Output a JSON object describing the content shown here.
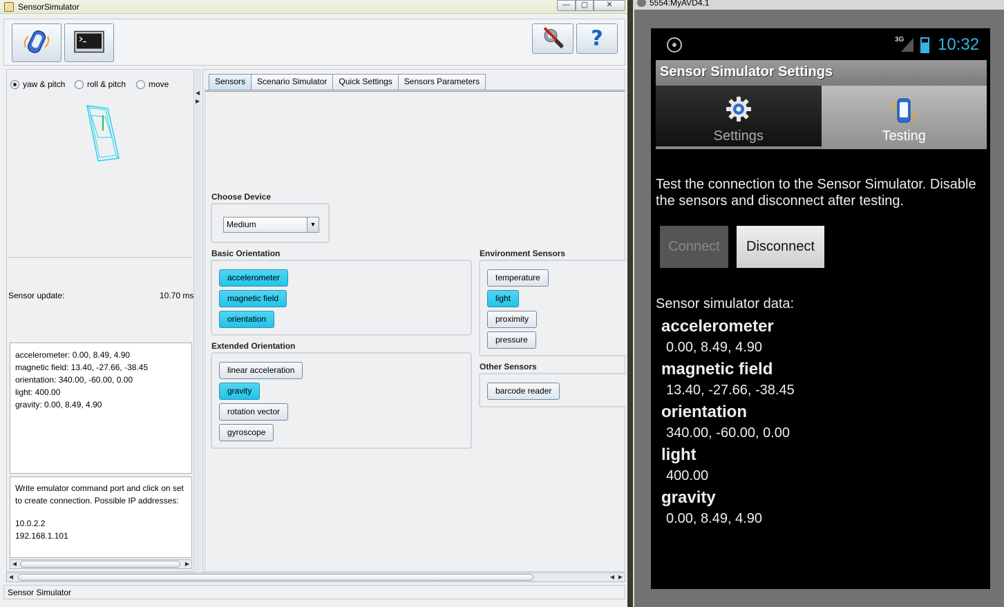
{
  "java_window": {
    "title": "SensorSimulator",
    "window_buttons": {
      "minimize": "—",
      "maximize": "▢",
      "close": "✕"
    },
    "toolbar": {
      "connect_icon": "phone-icon",
      "terminal_icon": "terminal-icon",
      "settings_icon": "tools-icon",
      "help_icon": "help-icon",
      "help_label": "?"
    },
    "left_panel": {
      "radio_options": [
        {
          "label": "yaw & pitch",
          "selected": true
        },
        {
          "label": "roll & pitch",
          "selected": false
        },
        {
          "label": "move",
          "selected": false
        }
      ],
      "sensor_update_label": "Sensor update:",
      "sensor_update_value": "10.70 ms",
      "sensor_values": [
        "accelerometer: 0.00, 8.49, 4.90",
        "magnetic field: 13.40, -27.66, -38.45",
        "orientation: 340.00, -60.00, 0.00",
        "light: 400.00",
        "gravity: 0.00, 8.49, 4.90"
      ],
      "help_text": "Write emulator command port and click on set to create connection. Possible IP addresses:",
      "ip_addresses": [
        "10.0.2.2",
        "192.168.1.101"
      ]
    },
    "tabs": [
      {
        "label": "Sensors",
        "active": true
      },
      {
        "label": "Scenario Simulator",
        "active": false
      },
      {
        "label": "Quick Settings",
        "active": false
      },
      {
        "label": "Sensors Parameters",
        "active": false
      }
    ],
    "choose_device": {
      "title": "Choose Device",
      "selected": "Medium"
    },
    "basic_orientation": {
      "title": "Basic Orientation",
      "buttons": [
        {
          "label": "accelerometer",
          "on": true
        },
        {
          "label": "magnetic field",
          "on": true
        },
        {
          "label": "orientation",
          "on": true
        }
      ]
    },
    "extended_orientation": {
      "title": "Extended Orientation",
      "buttons": [
        {
          "label": "linear acceleration",
          "on": false
        },
        {
          "label": "gravity",
          "on": true
        },
        {
          "label": "rotation vector",
          "on": false
        },
        {
          "label": "gyroscope",
          "on": false
        }
      ]
    },
    "environment_sensors": {
      "title": "Environment Sensors",
      "buttons": [
        {
          "label": "temperature",
          "on": false
        },
        {
          "label": "light",
          "on": true
        },
        {
          "label": "proximity",
          "on": false
        },
        {
          "label": "pressure",
          "on": false
        }
      ]
    },
    "other_sensors": {
      "title": "Other Sensors",
      "buttons": [
        {
          "label": "barcode reader",
          "on": false
        }
      ]
    },
    "status_bar": "Sensor Simulator",
    "colors": {
      "active_button": "#21c4ea",
      "device_outline": "#22d3ee",
      "device_line": "#22c55e"
    }
  },
  "emulator_window": {
    "title": "5554:MyAVD4.1",
    "status_bar": {
      "network": "3G",
      "time": "10:32"
    },
    "action_bar_title": "Sensor Simulator Settings",
    "tabs": [
      {
        "label": "Settings",
        "icon": "gear-icon",
        "active": false
      },
      {
        "label": "Testing",
        "icon": "phone-vibrate-icon",
        "active": true
      }
    ],
    "description": "Test the connection to the Sensor Simulator. Disable the sensors and disconnect after testing.",
    "connect_label": "Connect",
    "disconnect_label": "Disconnect",
    "data_title": "Sensor simulator data:",
    "sensors": [
      {
        "name": "accelerometer",
        "value": "0.00, 8.49, 4.90"
      },
      {
        "name": "magnetic field",
        "value": "13.40, -27.66, -38.45"
      },
      {
        "name": "orientation",
        "value": "340.00, -60.00, 0.00"
      },
      {
        "name": "light",
        "value": "400.00"
      },
      {
        "name": "gravity",
        "value": "0.00, 8.49, 4.90"
      }
    ],
    "colors": {
      "accent": "#33b5e5"
    }
  }
}
